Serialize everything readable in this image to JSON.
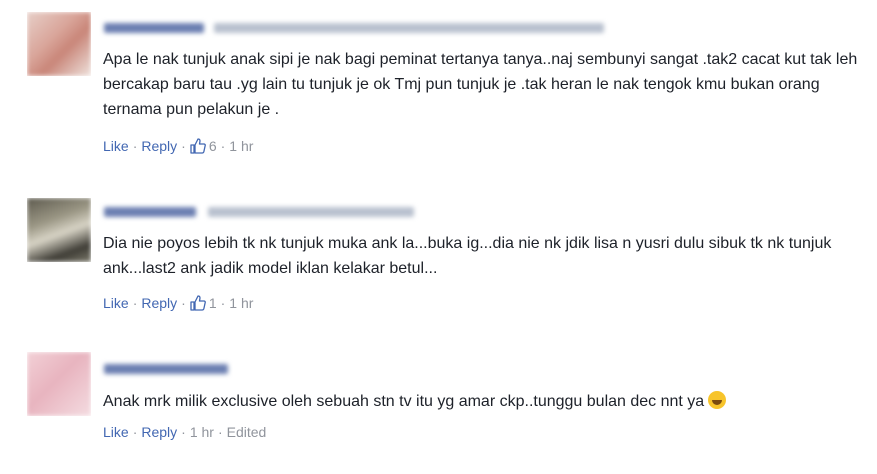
{
  "comments": [
    {
      "text": "Apa le nak tunjuk anak sipi je nak bagi peminat tertanya tanya..naj sembunyi sangat .tak2 cacat kut tak leh bercakap baru tau .yg lain tu tunjuk je ok Tmj pun tunjuk je .tak heran le nak tengok kmu bukan orang ternama pun pelakun je .",
      "like_label": "Like",
      "reply_label": "Reply",
      "reactions": "6",
      "time": "1 hr",
      "edited": ""
    },
    {
      "text": "Dia nie poyos lebih tk nk tunjuk muka ank la...buka ig...dia nie nk jdik lisa n yusri dulu sibuk tk nk tunjuk ank...last2 ank jadik model iklan kelakar betul...",
      "like_label": "Like",
      "reply_label": "Reply",
      "reactions": "1",
      "time": "1 hr",
      "edited": ""
    },
    {
      "text": "Anak mrk milik exclusive oleh sebuah stn tv itu yg amar ckp..tunggu bulan dec nnt ya",
      "emoji": "rolling-on-floor-laughing-emoji",
      "like_label": "Like",
      "reply_label": "Reply",
      "reactions": "",
      "time": "1 hr",
      "edited": "Edited"
    }
  ],
  "colors": {
    "link": "#4267b2",
    "text": "#1d2129",
    "meta": "#90949c"
  }
}
